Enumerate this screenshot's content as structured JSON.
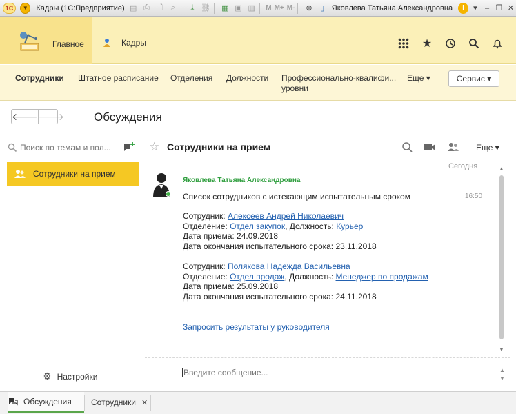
{
  "titlebar": {
    "logo": "1С",
    "app_title": "Кадры  (1С:Предприятие)",
    "m_label": "M",
    "m_plus_label": "M+",
    "m_minus_label": "M-",
    "user_name": "Яковлева Татьяна Александровна"
  },
  "sections": {
    "main_label": "Главное",
    "kadry_label": "Кадры"
  },
  "nav": {
    "items": [
      "Сотрудники",
      "Штатное расписание",
      "Отделения",
      "Должности",
      "Профессионально-квалифи...",
      "уровни"
    ],
    "more_label": "Еще ▾",
    "service_label": "Сервис ▾"
  },
  "form": {
    "back_glyph": "🡐",
    "forward_glyph": "🡒",
    "title": "Обсуждения"
  },
  "left": {
    "search_placeholder": "Поиск по темам и пол...",
    "discussion_item": "Сотрудники на прием",
    "settings_label": "Настройки"
  },
  "chat": {
    "title": "Сотрудники на прием",
    "more_label": "Еще ▾",
    "date_label": "Сегодня",
    "author": "Яковлева Татьяна Александровна",
    "time": "16:50",
    "intro": "Список сотрудников с истекающим испытательным сроком",
    "employees": [
      {
        "employee_prefix": "Сотрудник: ",
        "employee_name": "Алексеев Андрей Николаевич",
        "dept_prefix": "Отделение: ",
        "dept_name": "Отдел закупок",
        "position_prefix": ", Должность: ",
        "position_name": "Курьер",
        "hire_date": "Дата приема: 24.09.2018",
        "probation_end": "Дата окончания испытательного срока: 23.11.2018"
      },
      {
        "employee_prefix": "Сотрудник: ",
        "employee_name": "Полякова Надежда Васильевна",
        "dept_prefix": "Отделение: ",
        "dept_name": "Отдел продаж",
        "position_prefix": ", Должность: ",
        "position_name": "Менеджер по продажам",
        "hire_date": "Дата приема: 25.09.2018",
        "probation_end": "Дата окончания испытательного срока: 24.11.2018"
      }
    ],
    "action_link": "Запросить результаты у руководителя",
    "compose_placeholder": "Введите сообщение..."
  },
  "taskbar": {
    "tab1": "Обсуждения",
    "tab2": "Сотрудники",
    "close_glyph": "✕"
  },
  "colors": {
    "section_bg": "#fbf0b8",
    "active_section": "#f8e28c",
    "selected_item": "#f5c823",
    "author_green": "#2f9e3e",
    "link_blue": "#2361b0"
  }
}
